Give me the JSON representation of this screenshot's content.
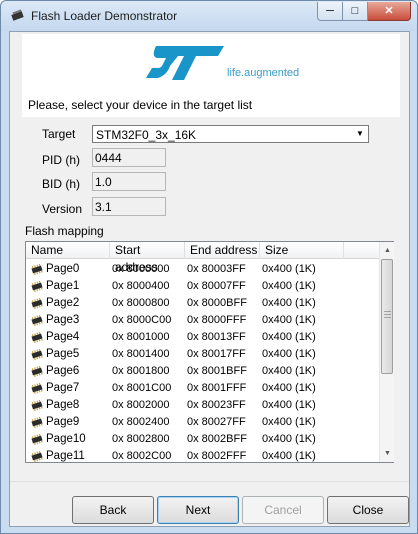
{
  "window": {
    "title": "Flash Loader Demonstrator"
  },
  "banner": {
    "logo_text": "ST",
    "tagline": "life.augmented",
    "brand_color": "#1a95c9"
  },
  "device": {
    "prompt": "Please, select your device in the target list",
    "target_label": "Target",
    "target_value": "STM32F0_3x_16K",
    "pid_label": "PID  (h)",
    "pid_value": "0444",
    "bid_label": "BID  (h)",
    "bid_value": "1.0",
    "version_label": "Version",
    "version_value": "3.1"
  },
  "flash_mapping": {
    "label": "Flash mapping",
    "columns": [
      "Name",
      "Start address",
      "End address",
      "Size"
    ],
    "rows": [
      [
        "Page0",
        "0x 8000000",
        "0x 80003FF",
        "0x400 (1K)"
      ],
      [
        "Page1",
        "0x 8000400",
        "0x 80007FF",
        "0x400 (1K)"
      ],
      [
        "Page2",
        "0x 8000800",
        "0x 8000BFF",
        "0x400 (1K)"
      ],
      [
        "Page3",
        "0x 8000C00",
        "0x 8000FFF",
        "0x400 (1K)"
      ],
      [
        "Page4",
        "0x 8001000",
        "0x 80013FF",
        "0x400 (1K)"
      ],
      [
        "Page5",
        "0x 8001400",
        "0x 80017FF",
        "0x400 (1K)"
      ],
      [
        "Page6",
        "0x 8001800",
        "0x 8001BFF",
        "0x400 (1K)"
      ],
      [
        "Page7",
        "0x 8001C00",
        "0x 8001FFF",
        "0x400 (1K)"
      ],
      [
        "Page8",
        "0x 8002000",
        "0x 80023FF",
        "0x400 (1K)"
      ],
      [
        "Page9",
        "0x 8002400",
        "0x 80027FF",
        "0x400 (1K)"
      ],
      [
        "Page10",
        "0x 8002800",
        "0x 8002BFF",
        "0x400 (1K)"
      ],
      [
        "Page11",
        "0x 8002C00",
        "0x 8002FFF",
        "0x400 (1K)"
      ]
    ]
  },
  "buttons": {
    "back": "Back",
    "next": "Next",
    "cancel": "Cancel",
    "close": "Close"
  }
}
